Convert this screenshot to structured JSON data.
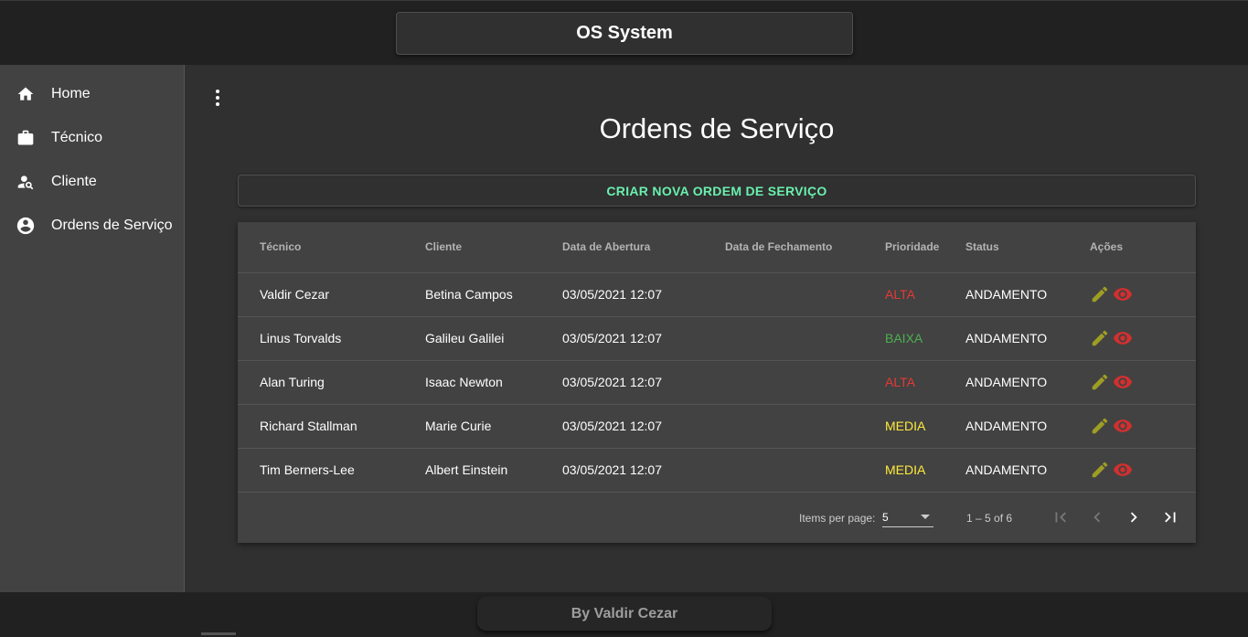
{
  "app": {
    "title": "OS System"
  },
  "sidebar": {
    "items": [
      {
        "label": "Home",
        "icon": "home-icon"
      },
      {
        "label": "Técnico",
        "icon": "briefcase-icon"
      },
      {
        "label": "Cliente",
        "icon": "person-search-icon"
      },
      {
        "label": "Ordens de Serviço",
        "icon": "account-circle-icon"
      }
    ]
  },
  "main": {
    "title": "Ordens de Serviço",
    "create_label": "CRIAR NOVA ORDEM DE SERVIÇO"
  },
  "table": {
    "headers": [
      "Técnico",
      "Cliente",
      "Data de Abertura",
      "Data de Fechamento",
      "Prioridade",
      "Status",
      "Ações"
    ],
    "rows": [
      {
        "tecnico": "Valdir Cezar",
        "cliente": "Betina Campos",
        "abertura": "03/05/2021 12:07",
        "fechamento": "",
        "prioridade": "ALTA",
        "status": "ANDAMENTO"
      },
      {
        "tecnico": "Linus Torvalds",
        "cliente": "Galileu Galilei",
        "abertura": "03/05/2021 12:07",
        "fechamento": "",
        "prioridade": "BAIXA",
        "status": "ANDAMENTO"
      },
      {
        "tecnico": "Alan Turing",
        "cliente": "Isaac Newton",
        "abertura": "03/05/2021 12:07",
        "fechamento": "",
        "prioridade": "ALTA",
        "status": "ANDAMENTO"
      },
      {
        "tecnico": "Richard Stallman",
        "cliente": "Marie Curie",
        "abertura": "03/05/2021 12:07",
        "fechamento": "",
        "prioridade": "MEDIA",
        "status": "ANDAMENTO"
      },
      {
        "tecnico": "Tim Berners-Lee",
        "cliente": "Albert Einstein",
        "abertura": "03/05/2021 12:07",
        "fechamento": "",
        "prioridade": "MEDIA",
        "status": "ANDAMENTO"
      }
    ]
  },
  "paginator": {
    "items_per_page_label": "Items per page:",
    "items_per_page_value": "5",
    "range_label": "1 – 5 of 6"
  },
  "colors": {
    "accent": "#69f0ae",
    "priority_alta": "#e53935",
    "priority_baixa": "#4caf50",
    "priority_media": "#ffeb3b",
    "edit_icon": "#9e9d24",
    "view_icon": "#d32f2f"
  },
  "footer": {
    "text": "By Valdir Cezar"
  }
}
